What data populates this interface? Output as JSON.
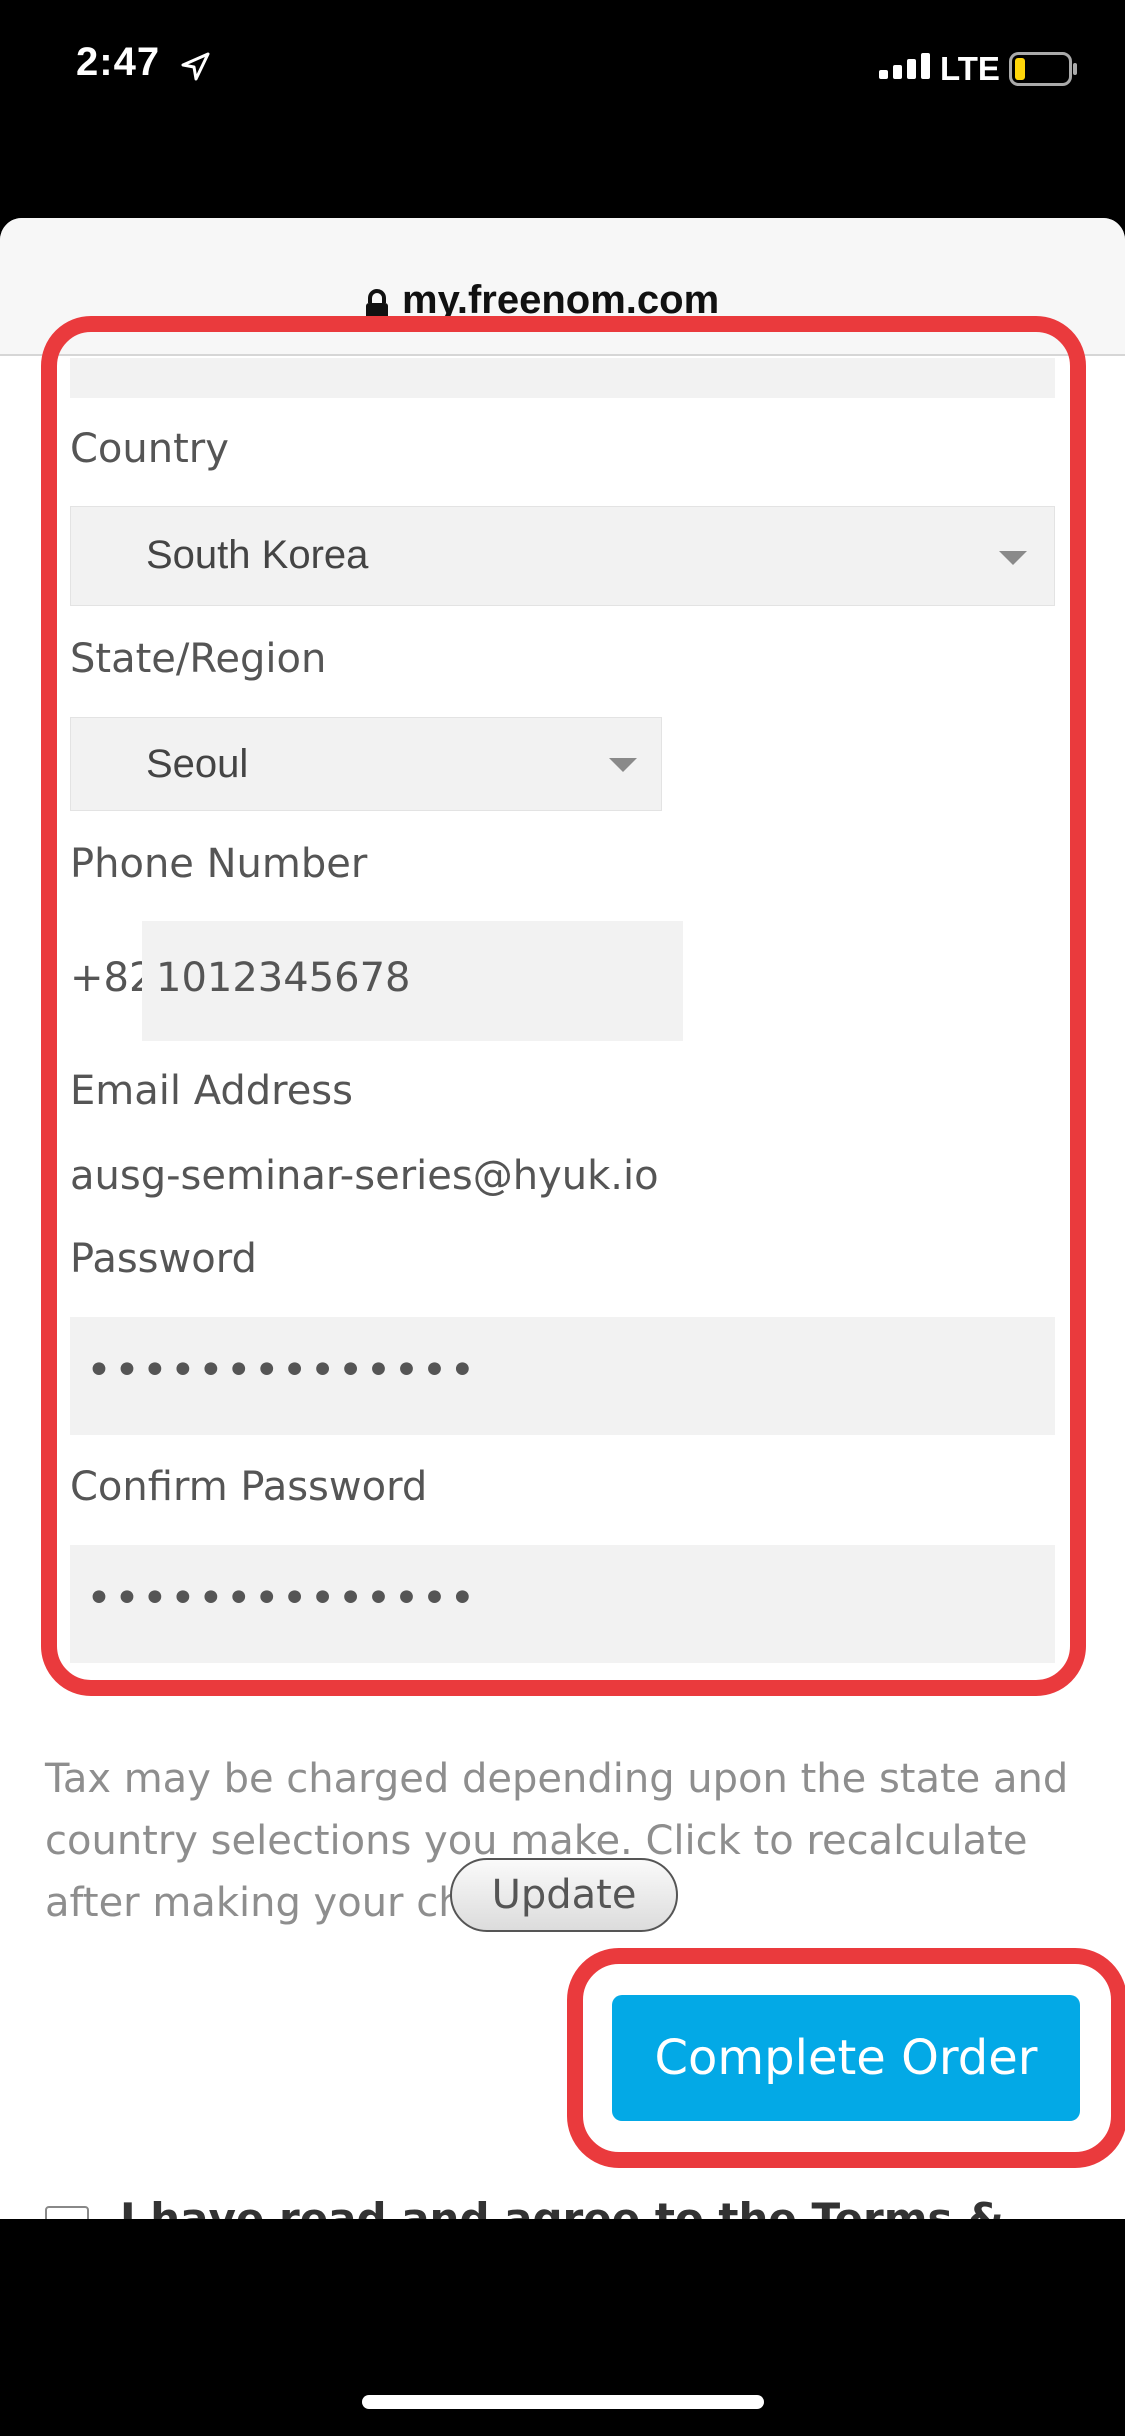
{
  "status_bar": {
    "time": "2:47",
    "network": "LTE",
    "icons": [
      "location-arrow-icon",
      "signal-icon",
      "battery-icon"
    ]
  },
  "browser": {
    "url": "my.freenom.com",
    "lock_icon": "lock-icon"
  },
  "form": {
    "country": {
      "label": "Country",
      "value": "South Korea"
    },
    "state": {
      "label": "State/Region",
      "value": "Seoul"
    },
    "phone": {
      "label": "Phone Number",
      "prefix": "+82",
      "value": "1012345678"
    },
    "email": {
      "label": "Email Address",
      "value": "ausg-seminar-series@hyuk.io"
    },
    "password": {
      "label": "Password",
      "masked_value": "••••••••••••••"
    },
    "confirm_password": {
      "label": "Confirm Password",
      "masked_value": "••••••••••••••"
    }
  },
  "tax": {
    "note": "Tax may be charged depending upon the state and country selections you make. Click to recalculate after making your choices.",
    "update_label": "Update"
  },
  "order": {
    "complete_label": "Complete Order",
    "terms_partial": "I have read and agree to the Terms &"
  },
  "colors": {
    "accent_button": "#03a9e6",
    "highlight": "#ea3a3d",
    "field_background": "#f2f2f2"
  }
}
